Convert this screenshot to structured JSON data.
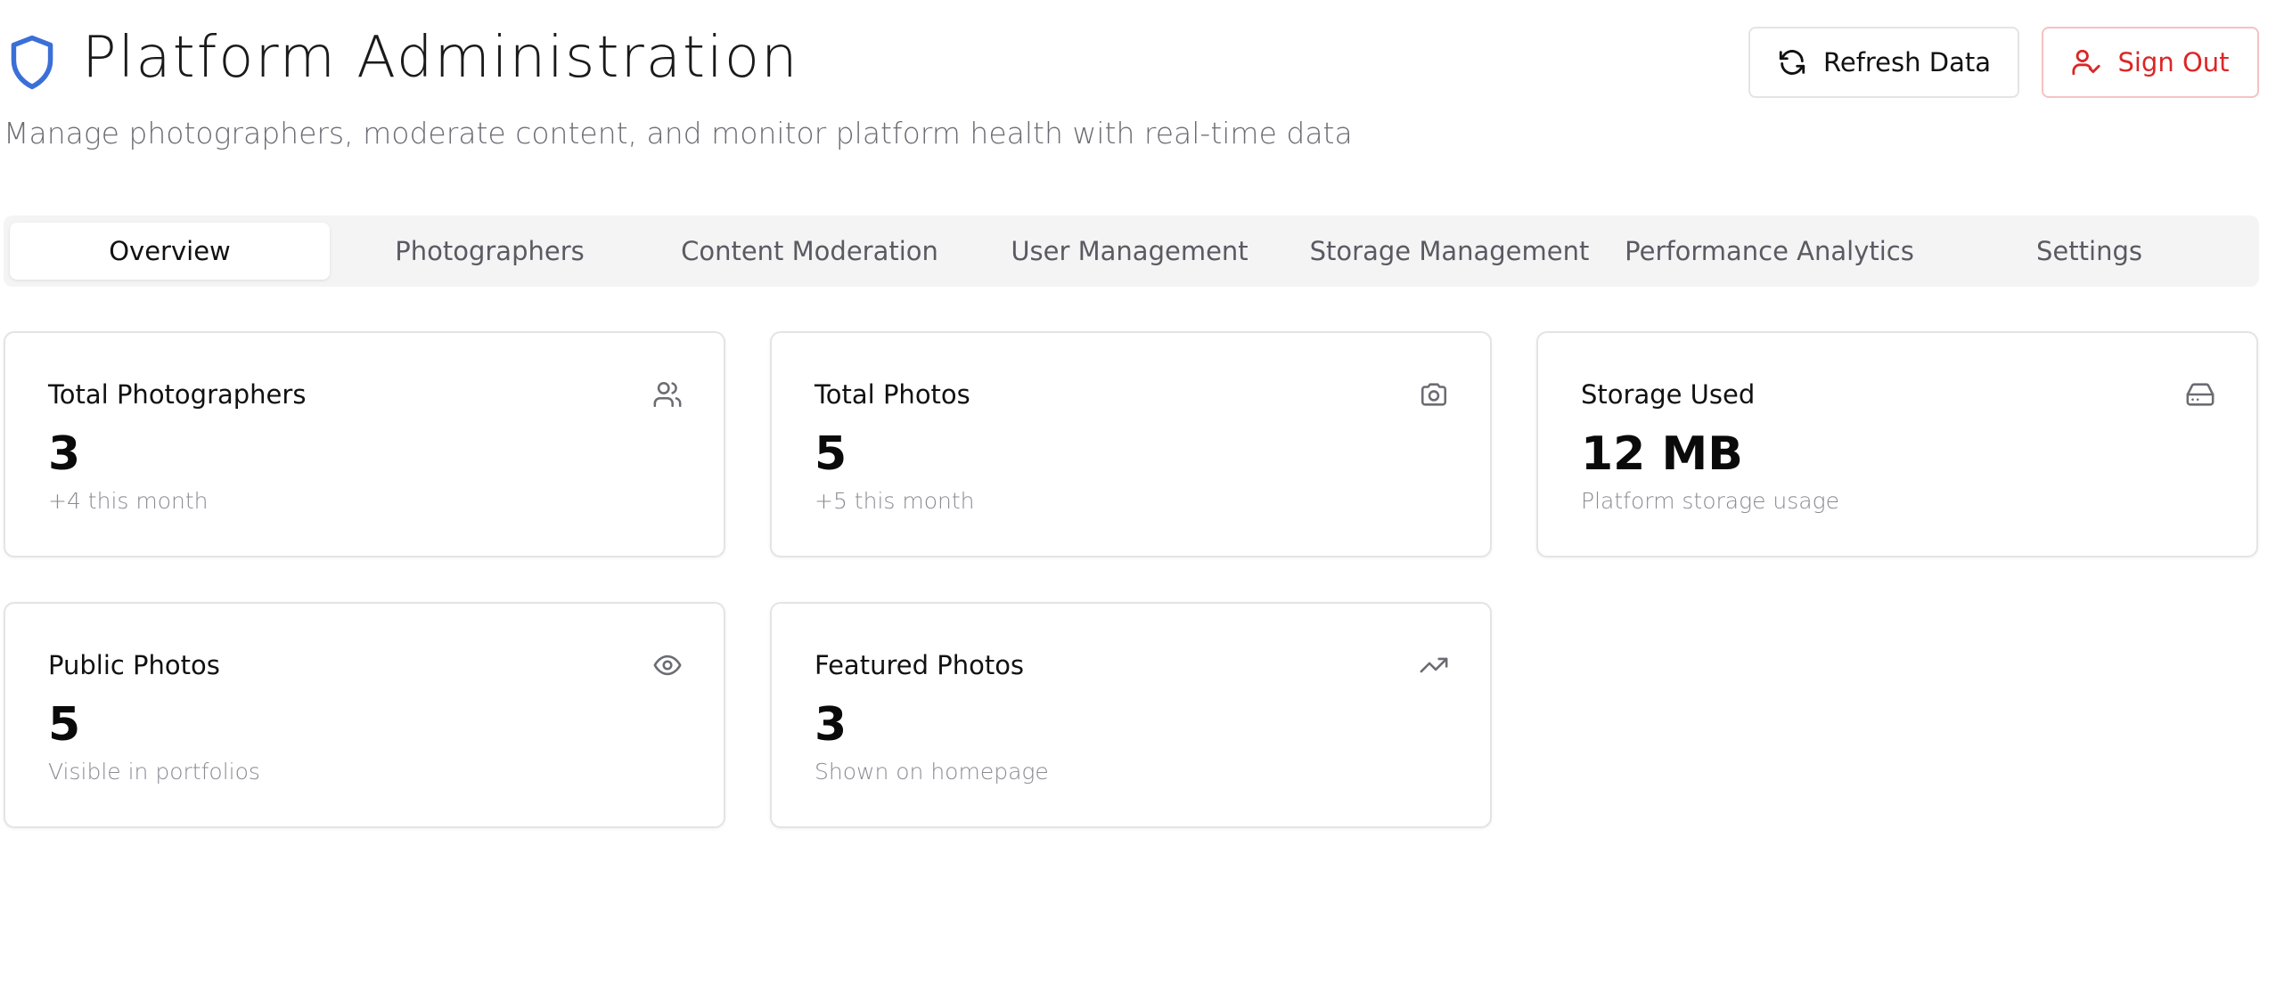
{
  "header": {
    "title": "Platform Administration",
    "subtitle": "Manage photographers, moderate content, and monitor platform health with real-time data",
    "icon": "shield-icon",
    "accent_color": "#3b6fd8"
  },
  "actions": {
    "refresh_label": "Refresh Data",
    "refresh_icon": "refresh-icon",
    "signout_label": "Sign Out",
    "signout_icon": "user-check-icon",
    "signout_color": "#dc2626"
  },
  "tabs": [
    {
      "label": "Overview",
      "active": true
    },
    {
      "label": "Photographers",
      "active": false
    },
    {
      "label": "Content Moderation",
      "active": false
    },
    {
      "label": "User Management",
      "active": false
    },
    {
      "label": "Storage Management",
      "active": false
    },
    {
      "label": "Performance Analytics",
      "active": false
    },
    {
      "label": "Settings",
      "active": false
    }
  ],
  "stats": [
    {
      "title": "Total Photographers",
      "value": "3",
      "note": "+4 this month",
      "icon": "users-icon"
    },
    {
      "title": "Total Photos",
      "value": "5",
      "note": "+5 this month",
      "icon": "camera-icon"
    },
    {
      "title": "Storage Used",
      "value": "12 MB",
      "note": "Platform storage usage",
      "icon": "hard-drive-icon"
    },
    {
      "title": "Public Photos",
      "value": "5",
      "note": "Visible in portfolios",
      "icon": "eye-icon"
    },
    {
      "title": "Featured Photos",
      "value": "3",
      "note": "Shown on homepage",
      "icon": "trending-up-icon"
    }
  ]
}
